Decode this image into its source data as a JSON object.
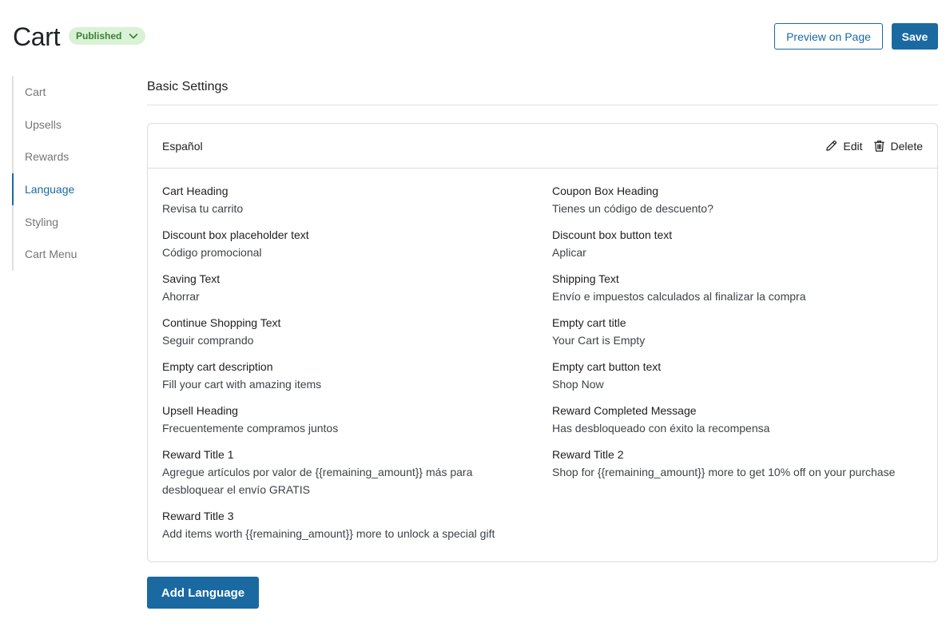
{
  "header": {
    "title": "Cart",
    "status": "Published",
    "preview_label": "Preview on Page",
    "save_label": "Save"
  },
  "sidebar": {
    "items": [
      {
        "label": "Cart",
        "active": false
      },
      {
        "label": "Upsells",
        "active": false
      },
      {
        "label": "Rewards",
        "active": false
      },
      {
        "label": "Language",
        "active": true
      },
      {
        "label": "Styling",
        "active": false
      },
      {
        "label": "Cart Menu",
        "active": false
      }
    ]
  },
  "main": {
    "section_title": "Basic Settings",
    "card": {
      "language": "Español",
      "edit_label": "Edit",
      "delete_label": "Delete",
      "fields": [
        {
          "label": "Cart Heading",
          "value": "Revisa tu carrito"
        },
        {
          "label": "Coupon Box Heading",
          "value": "Tienes un código de descuento?"
        },
        {
          "label": "Discount box placeholder text",
          "value": "Código promocional"
        },
        {
          "label": "Discount box button text",
          "value": "Aplicar"
        },
        {
          "label": "Saving Text",
          "value": "Ahorrar"
        },
        {
          "label": "Shipping Text",
          "value": "Envío e impuestos calculados al finalizar la compra"
        },
        {
          "label": "Continue Shopping Text",
          "value": "Seguir comprando"
        },
        {
          "label": "Empty cart title",
          "value": "Your Cart is Empty"
        },
        {
          "label": "Empty cart description",
          "value": "Fill your cart with amazing items"
        },
        {
          "label": "Empty cart button text",
          "value": "Shop Now"
        },
        {
          "label": "Upsell Heading",
          "value": "Frecuentemente compramos juntos"
        },
        {
          "label": "Reward Completed Message",
          "value": "Has desbloqueado con éxito la recompensa"
        },
        {
          "label": "Reward Title 1",
          "value": "Agregue artículos por valor de {{remaining_amount}} más para desbloquear el envío GRATIS"
        },
        {
          "label": "Reward Title 2",
          "value": "Shop for {{remaining_amount}} more to get 10% off on your purchase"
        },
        {
          "label": "Reward Title 3",
          "value": "Add items worth {{remaining_amount}} more to unlock a special gift"
        }
      ]
    },
    "add_language_label": "Add Language"
  },
  "colors": {
    "accent": "#1a6aa1",
    "published_bg": "#d9f2d5",
    "published_text": "#3e7d38"
  },
  "icons": {
    "status_dropdown": "chevron-down-icon",
    "edit": "pencil-icon",
    "delete": "trash-icon"
  }
}
